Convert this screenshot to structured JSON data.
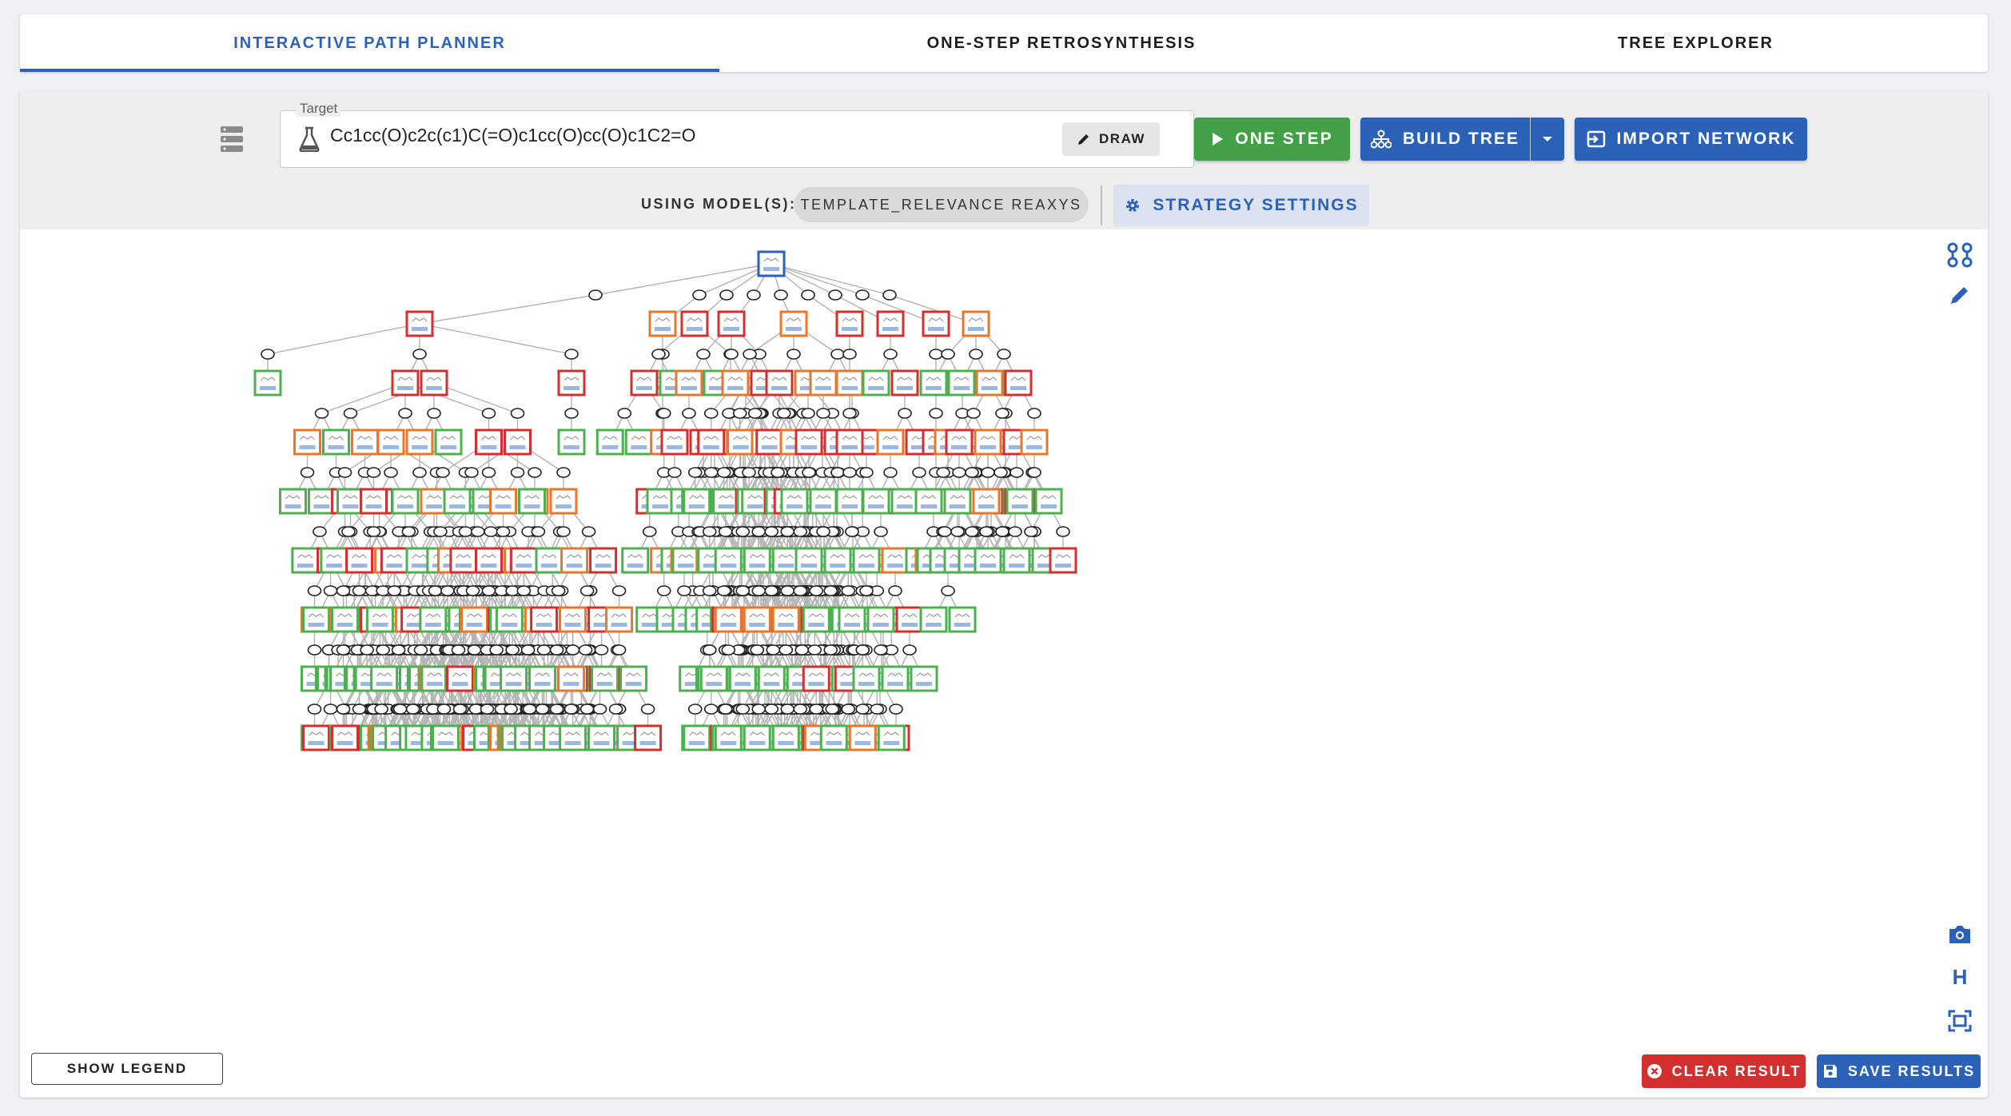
{
  "tabs": [
    {
      "label": "INTERACTIVE PATH PLANNER",
      "active": true
    },
    {
      "label": "ONE-STEP RETROSYNTHESIS",
      "active": false
    },
    {
      "label": "TREE EXPLORER",
      "active": false
    }
  ],
  "target": {
    "label": "Target",
    "smiles": "Cc1cc(O)c2c(c1)C(=O)c1cc(O)cc(O)c1C2=O",
    "draw_label": "DRAW"
  },
  "actions": {
    "one_step": "ONE STEP",
    "build_tree": "BUILD TREE",
    "import_network": "IMPORT NETWORK"
  },
  "models": {
    "label": "USING MODEL(S):",
    "chip": "TEMPLATE_RELEVANCE REAXYS",
    "strategy_label": "STRATEGY SETTINGS"
  },
  "legend_label": "SHOW LEGEND",
  "bottom": {
    "clear_label": "CLEAR RESULT",
    "save_label": "SAVE RESULTS"
  },
  "side_tools": {
    "hierarchy_label": "H"
  },
  "colors": {
    "accent": "#2b62b8",
    "success": "#43a047",
    "danger": "#d32f2f",
    "node_green": "#4caf50",
    "node_red": "#d32f2f",
    "node_orange": "#e8772e",
    "node_blue": "#2b62b8"
  },
  "icons": [
    "database-icon",
    "flask-icon",
    "pencil-icon",
    "play-icon",
    "tree-icon",
    "chevron-down-icon",
    "import-icon",
    "gear-icon",
    "graph-icon",
    "camera-icon",
    "fit-screen-icon",
    "close-circle-icon",
    "save-icon"
  ]
}
